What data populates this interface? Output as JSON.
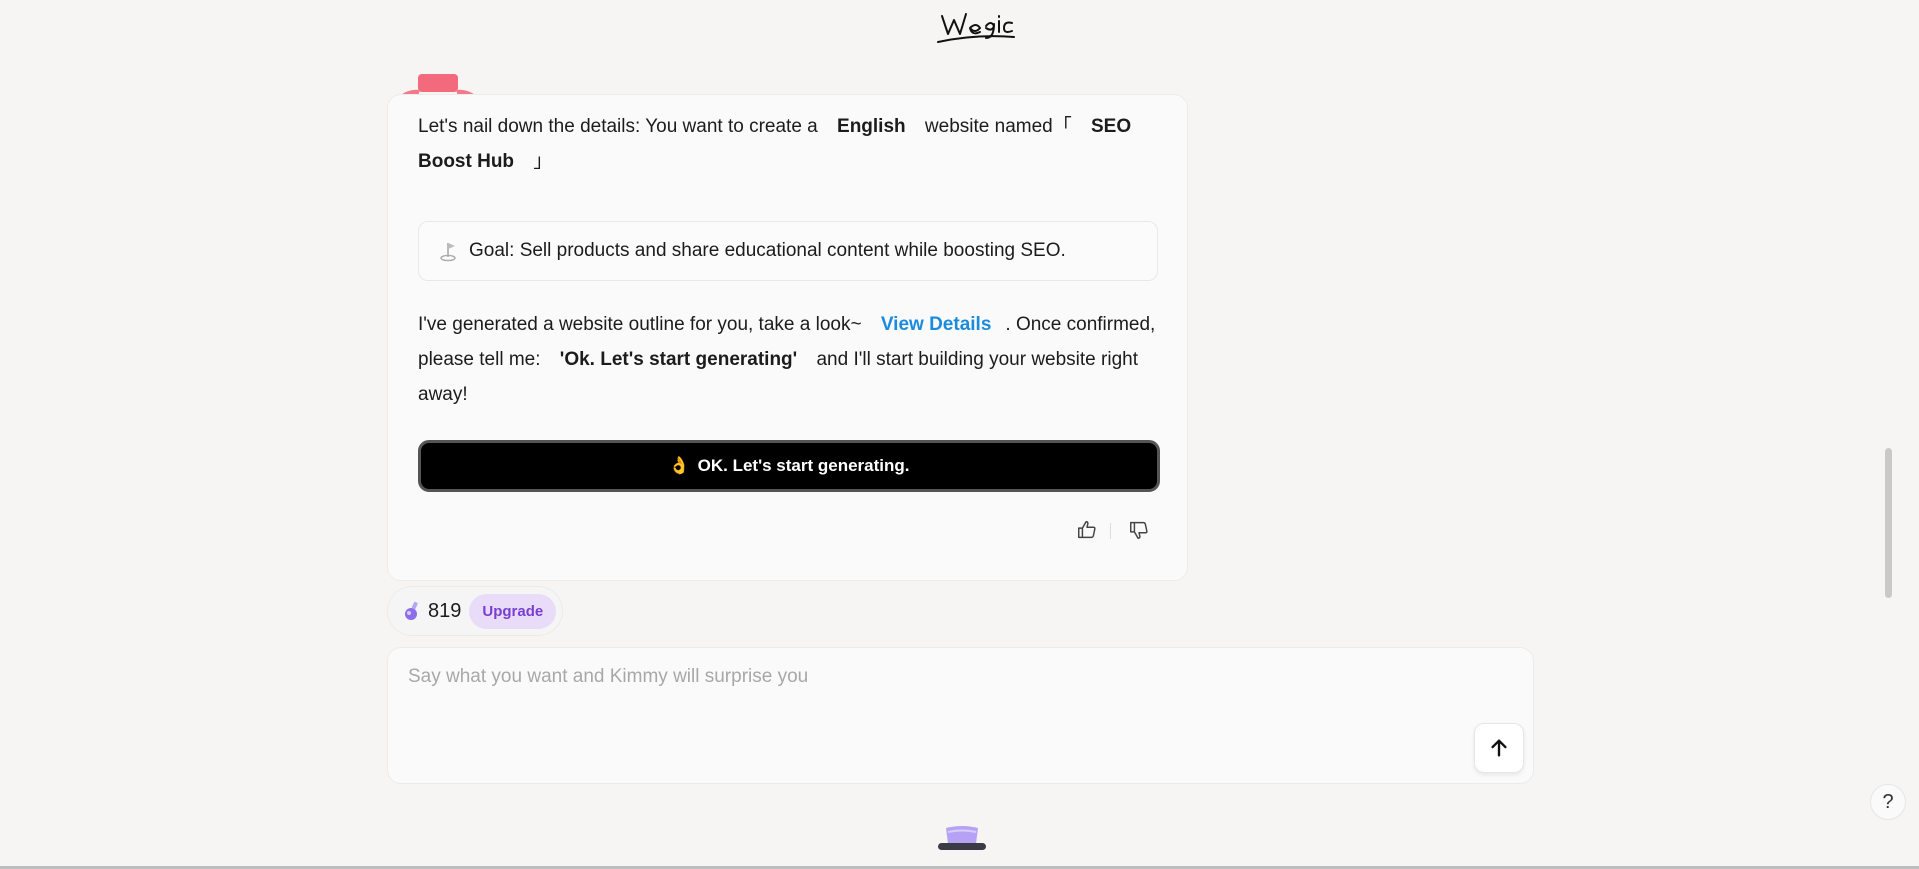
{
  "logo_text": "Wegic",
  "message": {
    "intro_pre": "Let's nail down the details: You want to create a",
    "language": "English",
    "intro_mid": "website named「",
    "site_name": "SEO Boost Hub",
    "intro_post": "」",
    "goal": "Goal: Sell products and share educational content while boosting SEO.",
    "outline_pre": "I've generated a website outline for you, take a look~",
    "view_details": "View Details",
    "outline_mid": ". Once confirmed, please tell me:",
    "confirm_phrase": "'Ok. Let's start generating'",
    "outline_post": "and I'll start building your website right away!",
    "generate_emoji": "👌",
    "generate_button": "OK. Let's start generating."
  },
  "credits": {
    "count": "819",
    "upgrade_label": "Upgrade"
  },
  "composer": {
    "placeholder": "Say what you want and Kimmy will surprise you"
  },
  "help_label": "?",
  "icons": [
    "goal-flag-icon",
    "thumbs-up-icon",
    "thumbs-down-icon",
    "credit-potion-icon",
    "arrow-up-icon",
    "help-icon"
  ],
  "colors": {
    "background": "#f6f5f4",
    "link": "#1a8cdf",
    "button_bg": "#000000",
    "upgrade_bg": "#e8dcf9",
    "upgrade_text": "#7a3fd0"
  }
}
